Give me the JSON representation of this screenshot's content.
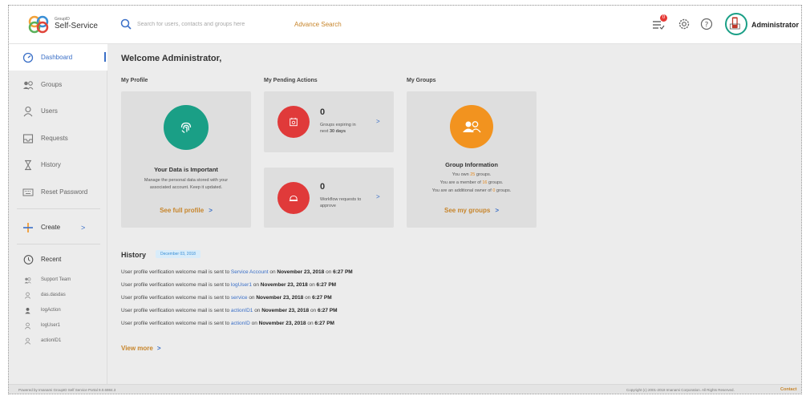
{
  "header": {
    "logo_small": "GroupID",
    "logo_main": "Self-Service",
    "search_placeholder": "Search for users, contacts and groups here",
    "advance_search": "Advance Search",
    "notification_count": "0",
    "user_name": "Administrator",
    "icons": [
      "search-icon",
      "notifications-icon",
      "settings-icon",
      "help-icon",
      "avatar"
    ]
  },
  "sidebar": {
    "items": [
      {
        "label": "Dashboard",
        "icon": "dashboard-icon"
      },
      {
        "label": "Groups",
        "icon": "groups-icon"
      },
      {
        "label": "Users",
        "icon": "user-icon"
      },
      {
        "label": "Requests",
        "icon": "inbox-icon"
      },
      {
        "label": "History",
        "icon": "hourglass-icon"
      },
      {
        "label": "Reset Password",
        "icon": "keyboard-icon"
      }
    ],
    "create": {
      "label": "Create",
      "chevron": ">"
    },
    "recent": {
      "label": "Recent",
      "items": [
        {
          "label": "Support Team",
          "icon": "group-icon"
        },
        {
          "label": "das.dasdas",
          "icon": "user-icon"
        },
        {
          "label": "logAction",
          "icon": "user-solid-icon"
        },
        {
          "label": "logUser1",
          "icon": "user-icon"
        },
        {
          "label": "actionID1",
          "icon": "user-icon"
        }
      ]
    }
  },
  "main": {
    "welcome": "Welcome Administrator,",
    "profile": {
      "section": "My Profile",
      "title": "Your Data is Important",
      "text1": "Manage the personal data stored with your",
      "text2": "associated account. Keep it updated.",
      "link": "See full profile",
      "chev": ">"
    },
    "pending": {
      "section": "My Pending Actions",
      "card1": {
        "count": "0",
        "text1": "Groups expiring in",
        "text2_pre": "next ",
        "text2_bold": "30 days",
        "chev": ">"
      },
      "card2": {
        "count": "0",
        "text1": "Workflow requests to",
        "text2": "approve",
        "chev": ">"
      }
    },
    "groups": {
      "section": "My Groups",
      "title": "Group Information",
      "l1_pre": "You own ",
      "l1_num": "25",
      "l1_post": " groups.",
      "l2_pre": "You are a member of ",
      "l2_num": "16",
      "l2_post": " groups.",
      "l3_pre": "You are an additional owner of ",
      "l3_num": "0",
      "l3_post": " groups.",
      "link": "See my groups",
      "chev": ">"
    },
    "history": {
      "title": "History",
      "date": "December 03, 2018",
      "prefix": "User profile verification welcome mail is sent to ",
      "on": " on ",
      "at": " on ",
      "entries": [
        {
          "target": "Service Account",
          "date": "November 23, 2018",
          "time": "6:27 PM"
        },
        {
          "target": "logUser1",
          "date": "November 23, 2018",
          "time": "6:27 PM"
        },
        {
          "target": "service",
          "date": "November 23, 2018",
          "time": "6:27 PM"
        },
        {
          "target": "actionID1",
          "date": "November 23, 2018",
          "time": "6:27 PM"
        },
        {
          "target": "actionID",
          "date": "November 23, 2018",
          "time": "6:27 PM"
        }
      ],
      "view_more": "View more",
      "chev": ">"
    }
  },
  "footer": {
    "left": "Powered by Imanami GroupID Self Service Portal 9.0.6984.3",
    "right": "Copyright (c) 2001-2018 Imanami Corporation. All Rights Reserved.",
    "contact": "Contact"
  },
  "colors": {
    "accent_blue": "#3a6fc7",
    "link_orange": "#c7852b",
    "profile_green": "#1a9f86",
    "pending_red": "#e03a3a",
    "groups_orange": "#f2931f"
  }
}
